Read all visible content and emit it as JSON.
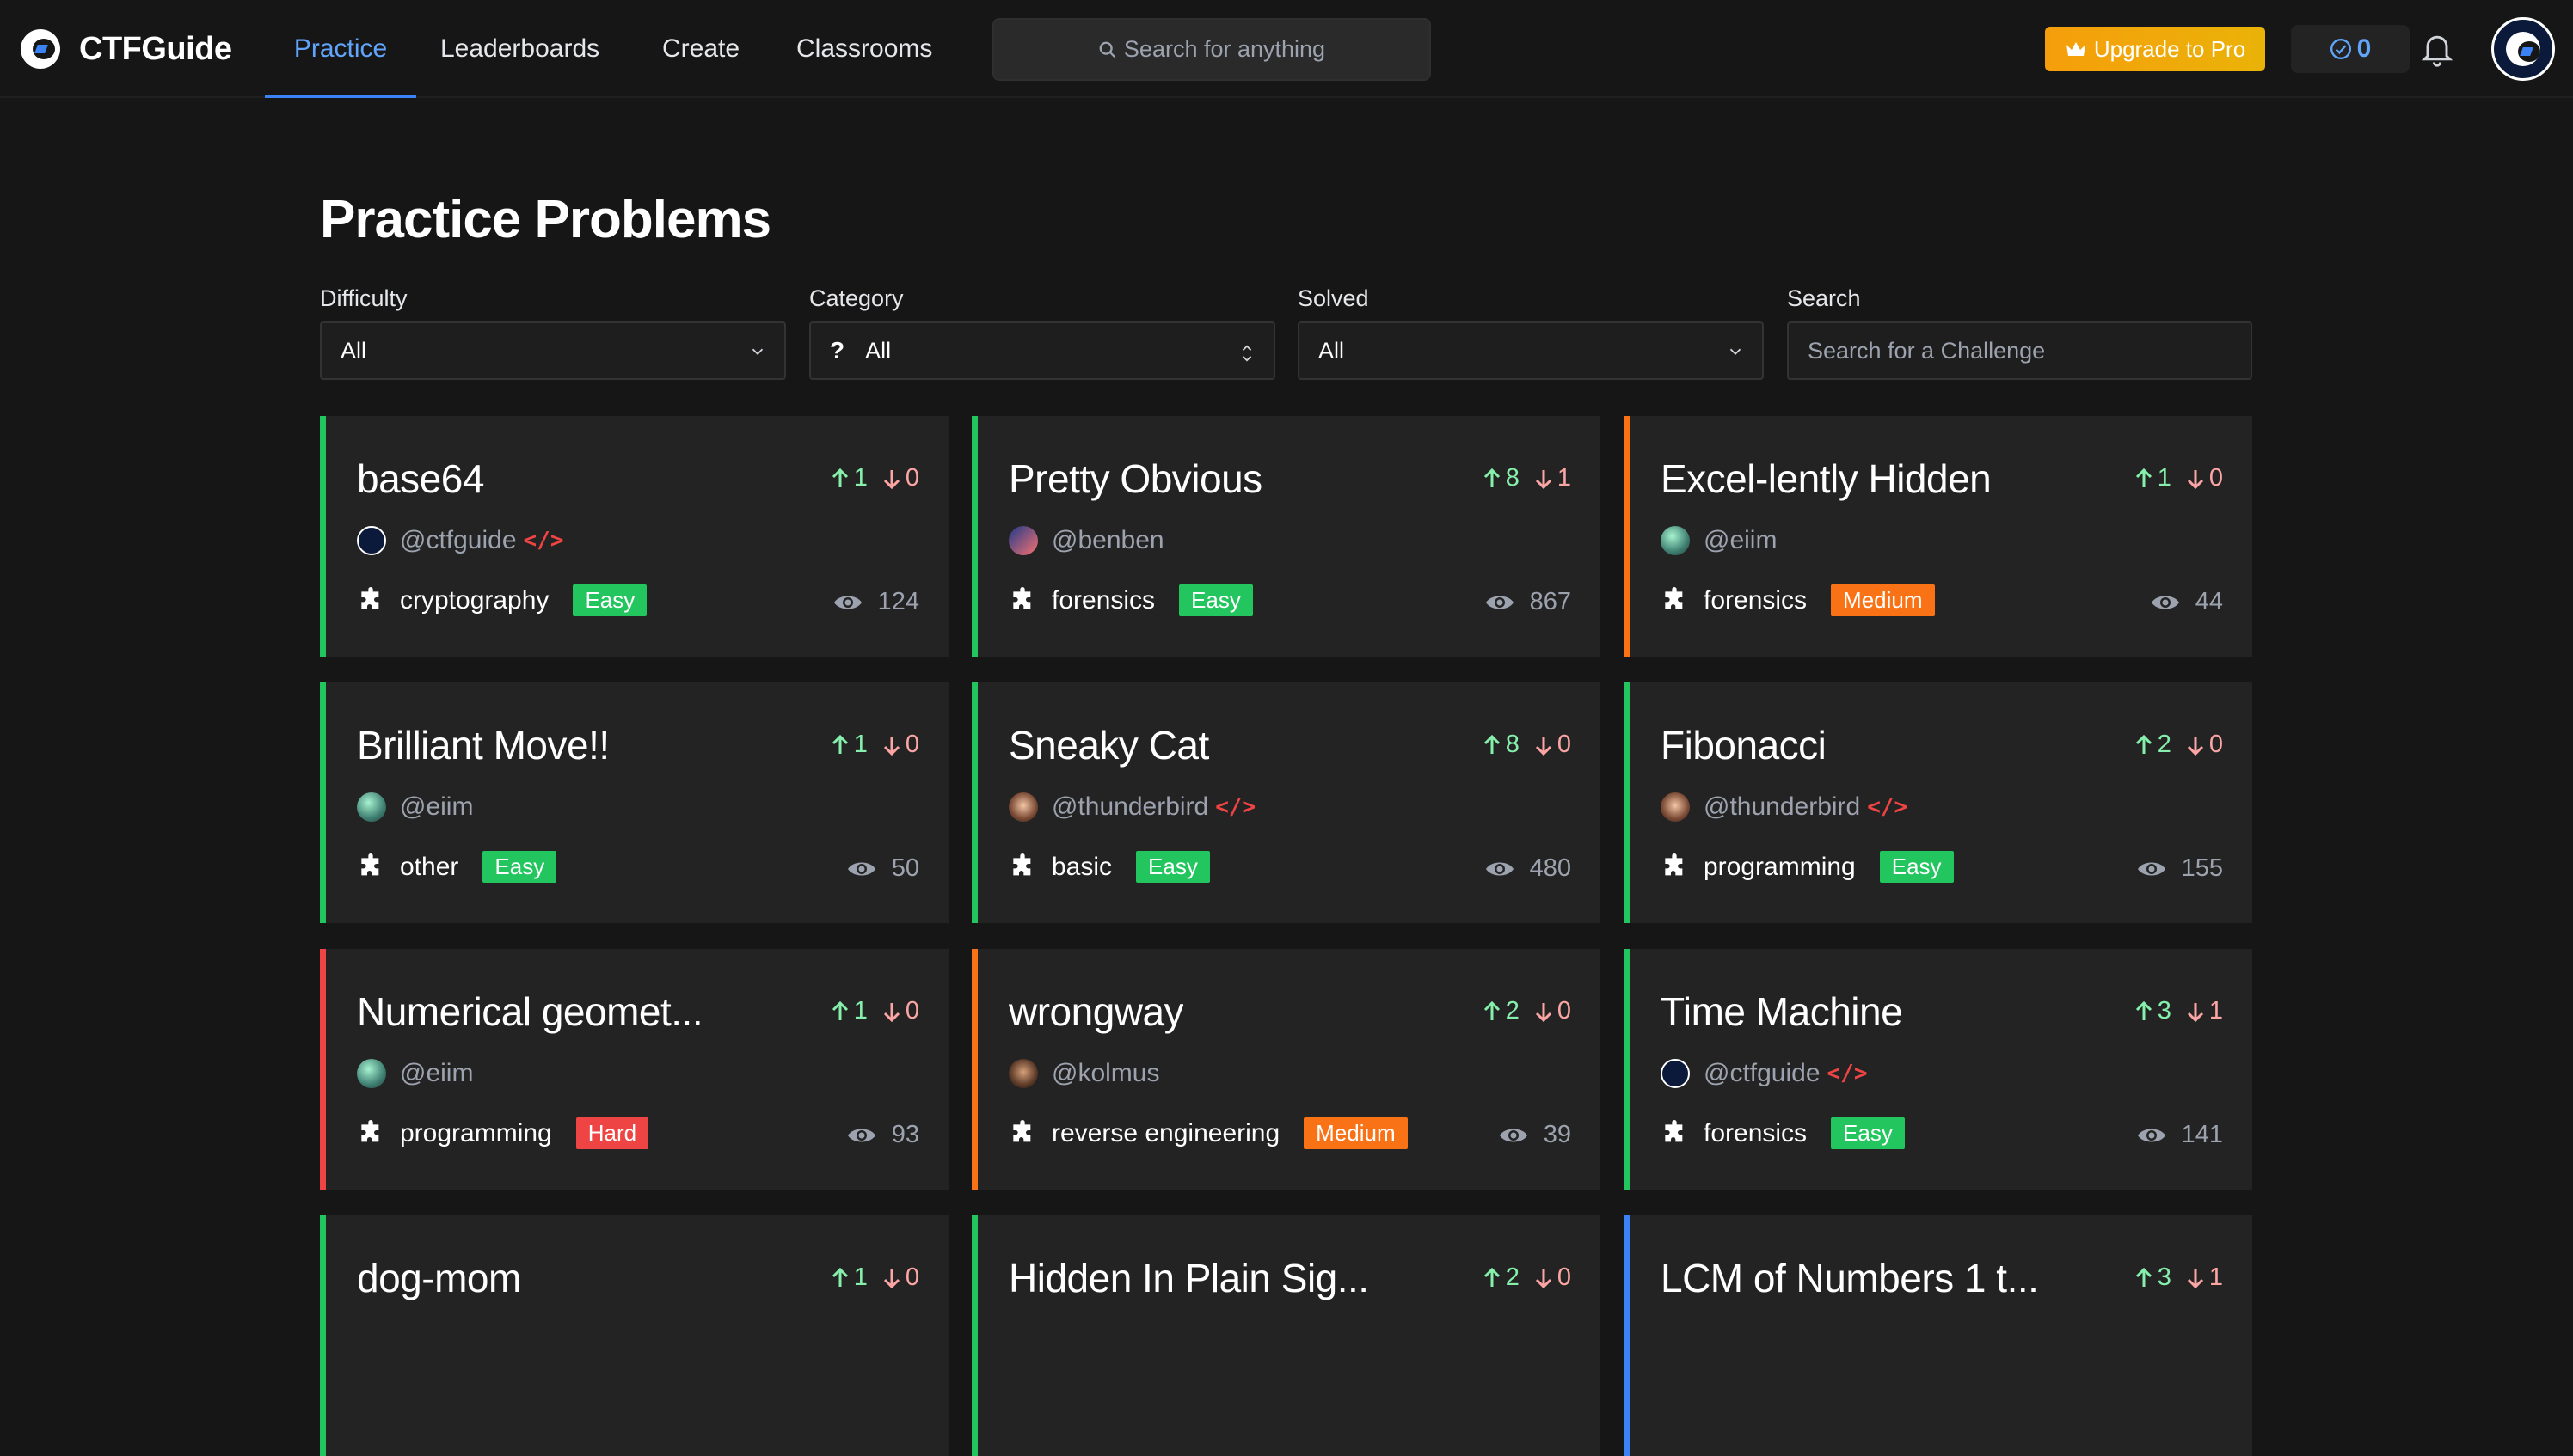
{
  "nav": {
    "brand": "CTFGuide",
    "links": [
      "Practice",
      "Leaderboards",
      "Create",
      "Classrooms"
    ],
    "search_placeholder": "Search for anything",
    "upgrade_label": "Upgrade to Pro",
    "points": "0"
  },
  "page": {
    "title": "Practice Problems"
  },
  "filters": {
    "difficulty_label": "Difficulty",
    "difficulty_value": "All",
    "category_label": "Category",
    "category_value": "All",
    "solved_label": "Solved",
    "solved_value": "All",
    "search_label": "Search",
    "search_placeholder": "Search for a Challenge"
  },
  "challenges": [
    {
      "title": "base64",
      "author": "@ctfguide",
      "category": "cryptography",
      "difficulty": "Easy",
      "views": "124",
      "up": "1",
      "down": "0"
    },
    {
      "title": "Pretty Obvious",
      "author": "@benben",
      "category": "forensics",
      "difficulty": "Easy",
      "views": "867",
      "up": "8",
      "down": "1"
    },
    {
      "title": "Excel-lently Hidden",
      "author": "@eiim",
      "category": "forensics",
      "difficulty": "Medium",
      "views": "44",
      "up": "1",
      "down": "0"
    },
    {
      "title": "Brilliant Move!!",
      "author": "@eiim",
      "category": "other",
      "difficulty": "Easy",
      "views": "50",
      "up": "1",
      "down": "0"
    },
    {
      "title": "Sneaky Cat",
      "author": "@thunderbird",
      "category": "basic",
      "difficulty": "Easy",
      "views": "480",
      "up": "8",
      "down": "0"
    },
    {
      "title": "Fibonacci",
      "author": "@thunderbird",
      "category": "programming",
      "difficulty": "Easy",
      "views": "155",
      "up": "2",
      "down": "0"
    },
    {
      "title": "Numerical geomet...",
      "author": "@eiim",
      "category": "programming",
      "difficulty": "Hard",
      "views": "93",
      "up": "1",
      "down": "0"
    },
    {
      "title": "wrongway",
      "author": "@kolmus",
      "category": "reverse engineering",
      "difficulty": "Medium",
      "views": "39",
      "up": "2",
      "down": "0"
    },
    {
      "title": "Time Machine",
      "author": "@ctfguide",
      "category": "forensics",
      "difficulty": "Easy",
      "views": "141",
      "up": "3",
      "down": "1"
    },
    {
      "title": "dog-mom",
      "up": "1",
      "down": "0"
    },
    {
      "title": "Hidden In Plain Sig...",
      "up": "2",
      "down": "0"
    },
    {
      "title": "LCM of Numbers 1 t...",
      "up": "3",
      "down": "1"
    }
  ]
}
